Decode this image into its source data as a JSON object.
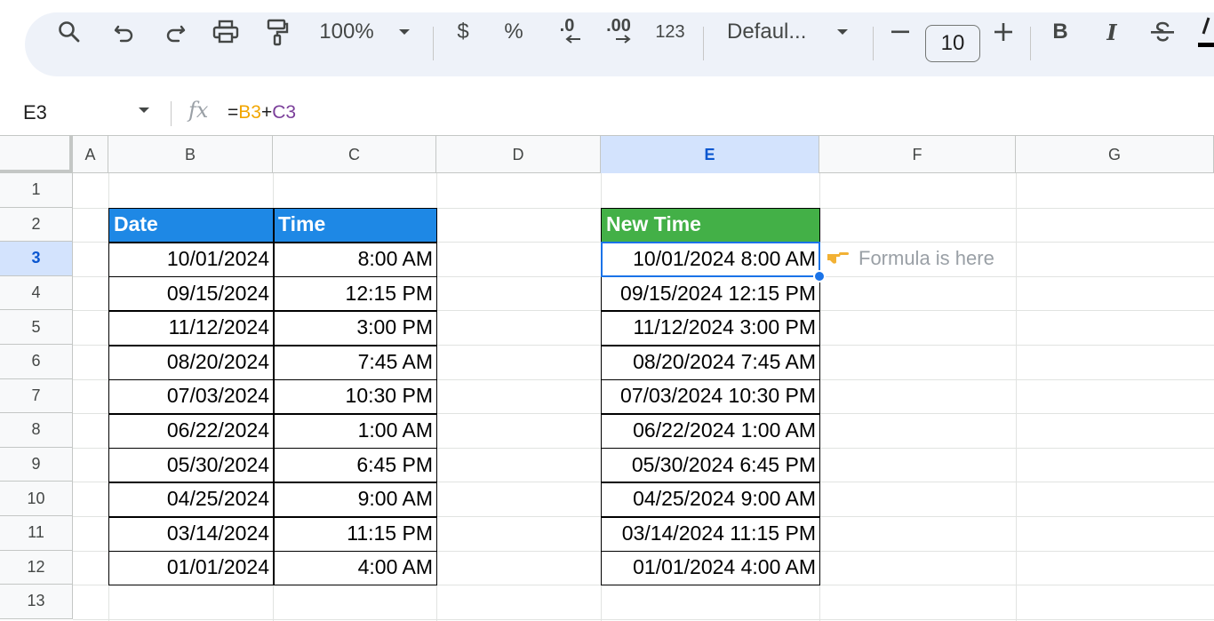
{
  "toolbar": {
    "zoom": "100%",
    "currency": "$",
    "percent": "%",
    "decrease_decimal": ".0",
    "increase_decimal": ".00",
    "number_format": "123",
    "font": "Defaul...",
    "font_size": "10",
    "bold": "B",
    "italic": "I"
  },
  "formula_bar": {
    "cell_ref": "E3",
    "fx": "fx",
    "formula_eq": "=",
    "formula_ref1": "B3",
    "formula_op": "+",
    "formula_ref2": "C3"
  },
  "columns": [
    "A",
    "B",
    "C",
    "D",
    "E",
    "F",
    "G"
  ],
  "rows": [
    "1",
    "2",
    "3",
    "4",
    "5",
    "6",
    "7",
    "8",
    "9",
    "10",
    "11",
    "12",
    "13"
  ],
  "active_cell": "E3",
  "table": {
    "date_header": "Date",
    "time_header": "Time",
    "new_time_header": "New Time",
    "rows": [
      {
        "date": "10/01/2024",
        "time": "8:00 AM",
        "new_time": "10/01/2024 8:00 AM"
      },
      {
        "date": "09/15/2024",
        "time": "12:15 PM",
        "new_time": "09/15/2024 12:15 PM"
      },
      {
        "date": "11/12/2024",
        "time": "3:00 PM",
        "new_time": "11/12/2024 3:00 PM"
      },
      {
        "date": "08/20/2024",
        "time": "7:45 AM",
        "new_time": "08/20/2024 7:45 AM"
      },
      {
        "date": "07/03/2024",
        "time": "10:30 PM",
        "new_time": "07/03/2024 10:30 PM"
      },
      {
        "date": "06/22/2024",
        "time": "1:00 AM",
        "new_time": "06/22/2024 1:00 AM"
      },
      {
        "date": "05/30/2024",
        "time": "6:45 PM",
        "new_time": "05/30/2024 6:45 PM"
      },
      {
        "date": "04/25/2024",
        "time": "9:00 AM",
        "new_time": "04/25/2024 9:00 AM"
      },
      {
        "date": "03/14/2024",
        "time": "11:15 PM",
        "new_time": "03/14/2024 11:15 PM"
      },
      {
        "date": "01/01/2024",
        "time": "4:00 AM",
        "new_time": "01/01/2024 4:00 AM"
      }
    ]
  },
  "annotation": {
    "text": "Formula is here",
    "icon": "pointing-hand-icon"
  },
  "colors": {
    "date_header_bg": "#1e88e5",
    "new_time_header_bg": "#43b047",
    "selection": "#1a73e8",
    "ref1": "#f2a600",
    "ref2": "#7b3f9a"
  }
}
